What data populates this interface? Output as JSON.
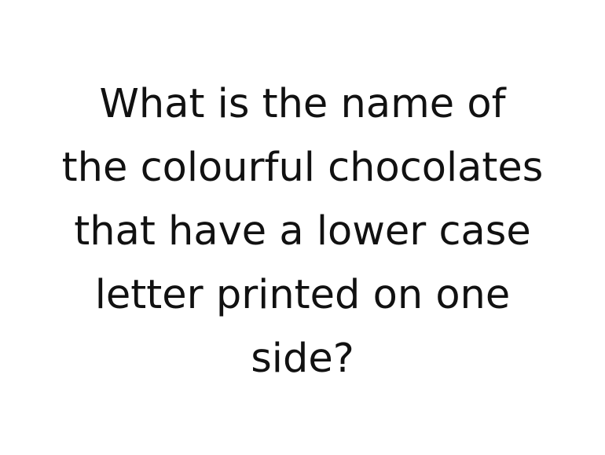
{
  "slide": {
    "question_lines": [
      "What is the name of",
      "the colourful chocolates",
      "that have a lower case",
      "letter printed on one",
      "side?"
    ]
  }
}
